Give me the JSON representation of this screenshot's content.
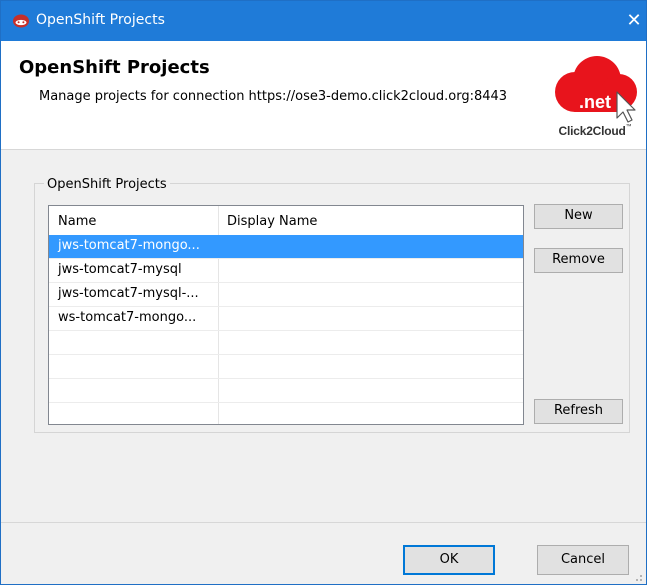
{
  "window": {
    "title": "OpenShift Projects",
    "close_glyph": "✕",
    "app_icon": "openshift-icon"
  },
  "header": {
    "title": "OpenShift Projects",
    "description": "Manage projects for connection https://ose3-demo.click2cloud.org:8443",
    "logo": {
      "badge": ".net",
      "wordmark": "Click2Cloud",
      "trademark": "™",
      "cloud_color": "#e8141c"
    }
  },
  "group": {
    "legend": "OpenShift Projects"
  },
  "table": {
    "columns": [
      "Name",
      "Display Name"
    ],
    "rows": [
      {
        "name": "jws-tomcat7-mongo...",
        "display_name": "",
        "selected": true
      },
      {
        "name": "jws-tomcat7-mysql",
        "display_name": "",
        "selected": false
      },
      {
        "name": "jws-tomcat7-mysql-...",
        "display_name": "",
        "selected": false
      },
      {
        "name": "ws-tomcat7-mongo...",
        "display_name": "",
        "selected": false
      },
      {
        "name": "",
        "display_name": "",
        "selected": false
      },
      {
        "name": "",
        "display_name": "",
        "selected": false
      },
      {
        "name": "",
        "display_name": "",
        "selected": false
      },
      {
        "name": "",
        "display_name": "",
        "selected": false
      }
    ],
    "selection_color": "#3399ff"
  },
  "buttons": {
    "new": "New",
    "remove": "Remove",
    "refresh": "Refresh",
    "ok": "OK",
    "cancel": "Cancel"
  },
  "colors": {
    "titlebar": "#1f7bd8",
    "accent": "#0078d7"
  }
}
